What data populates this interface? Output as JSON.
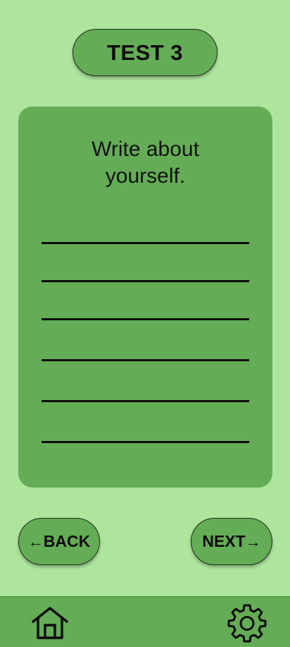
{
  "header": {
    "title": "TEST 3"
  },
  "card": {
    "prompt": "Write about yourself.",
    "answer_lines": 6
  },
  "navigation": {
    "back_label": "BACK",
    "next_label": "NEXT",
    "back_arrow": "←",
    "next_arrow": "→"
  },
  "bottom_bar": {
    "icons": [
      "home-icon",
      "gear-icon"
    ]
  },
  "colors": {
    "background": "#aee59d",
    "panel": "#64ac56",
    "text": "#0d0d0d"
  }
}
